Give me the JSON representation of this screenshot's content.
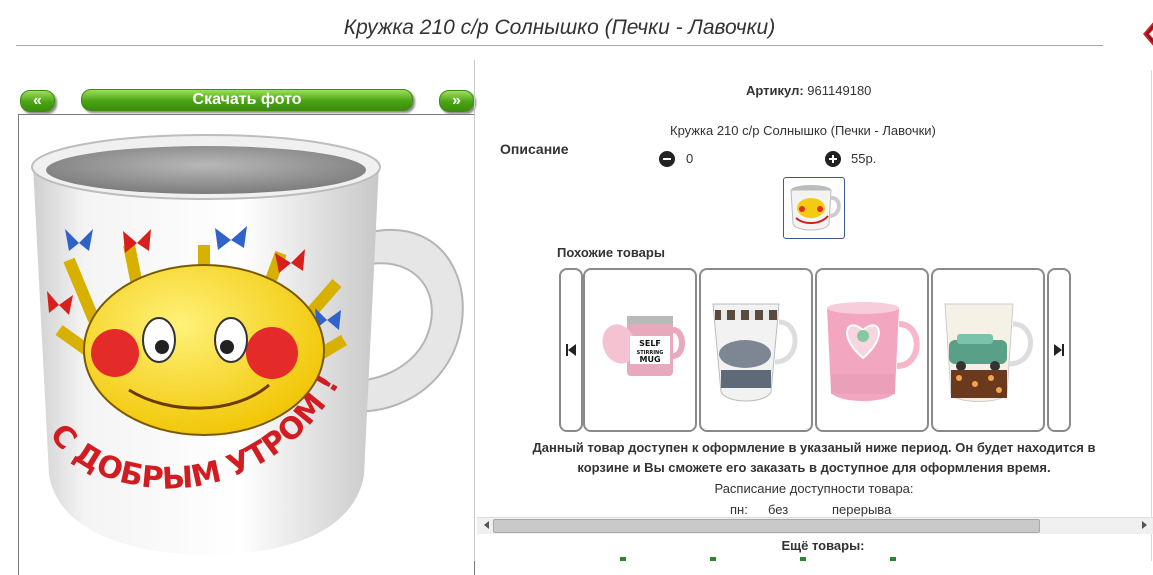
{
  "title": "Кружка 210 с/р Солнышко (Печки - Лавочки)",
  "gallery": {
    "prev_label": "«",
    "download_label": "Скачать фото",
    "next_label": "»",
    "mug_text": "С ДОБРЫМ УТРОМ !"
  },
  "product": {
    "article_label": "Артикул:",
    "article_value": "961149180",
    "description_label": "Описание",
    "description_text": "Кружка 210 с/р Солнышко (Печки - Лавочки)",
    "quantity": "0",
    "price": "55р."
  },
  "similar": {
    "heading": "Похожие товары",
    "items": [
      {
        "name": "self-stirring-mug",
        "mug_text": "SELF STIRRING MUG"
      },
      {
        "name": "fashion-mug",
        "mug_text": ""
      },
      {
        "name": "pink-heart-mug",
        "mug_text": ""
      },
      {
        "name": "car-mug",
        "mug_text": ""
      }
    ]
  },
  "availability": {
    "notice_line1": "Данный товар доступен к оформление в указаный ниже период. Он будет находится в",
    "notice_line2": "корзине и Вы сможете его заказать в доступное для оформления время.",
    "schedule_label": "Расписание доступности товара:",
    "day": "пн:",
    "time": "без",
    "break": "перерыва"
  },
  "more": {
    "heading": "Ещё товары:"
  },
  "colors": {
    "green_button": "#4aa314",
    "close_red": "#cc1f26"
  }
}
